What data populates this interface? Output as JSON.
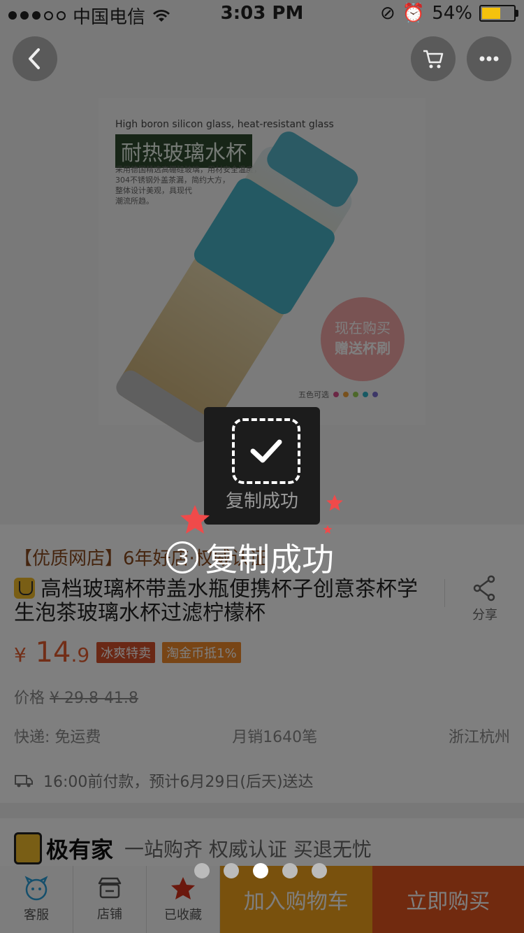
{
  "status_bar": {
    "carrier": "中国电信",
    "time": "3:03 PM",
    "battery": "54%",
    "battery_level": 0.54
  },
  "nav": {
    "back_icon": "back-arrow-icon",
    "cart_icon": "cart-icon",
    "more_icon": "more-dots-icon"
  },
  "product_image": {
    "en_headline": "High boron silicon glass, heat-resistant glass",
    "cn_title": "耐热玻璃水杯",
    "desc_1": "采用德国精选高硼硅玻璃，用材安全温度，",
    "desc_2": "304不锈钢外盖茶漏，简约大方，",
    "desc_3": "整体设计美观，具现代",
    "desc_4": "潮流所趋。",
    "promo_1": "现在购买",
    "promo_2": "赠送杯刷",
    "colors_label": "五色可选",
    "colors": [
      "#d6508a",
      "#f0a33a",
      "#9ad054",
      "#2fb3c6",
      "#7b6fcf"
    ]
  },
  "shop": {
    "line": "【优质网店】6年好店·权威认证"
  },
  "product": {
    "title": "高档玻璃杯带盖水瓶便携杯子创意茶杯学生泡茶玻璃水杯过滤柠檬杯",
    "share_label": "分享",
    "currency": "¥",
    "price_main": "14",
    "price_decimal": ".9",
    "tag_1": "冰爽特卖",
    "tag_2": "淘金币抵1%",
    "original_label": "价格",
    "original_range": "¥ 29.8-41.8",
    "shipping": "快递: 免运费",
    "monthly_sales": "月销1640笔",
    "location": "浙江杭州",
    "delivery": "16:00前付款，预计6月29日(后天)送达"
  },
  "jiyoujia": {
    "logo": "极有家",
    "slogan": "一站购齐 权威认证 买退无忧"
  },
  "bottom_bar": {
    "service": "客服",
    "store": "店铺",
    "favorite": "已收藏",
    "add_cart": "加入购物车",
    "buy_now": "立即购买"
  },
  "carousel": {
    "count": 5,
    "active_index": 2
  },
  "toast": {
    "text": "复制成功",
    "icon": "check-icon"
  },
  "annotation": {
    "number": "3",
    "text": "复制成功"
  }
}
